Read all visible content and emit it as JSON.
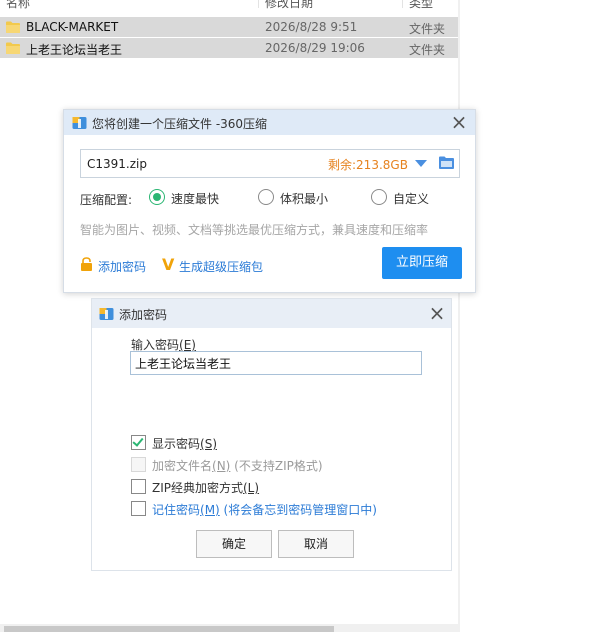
{
  "explorer": {
    "columns": {
      "name": "名称",
      "date": "修改日期",
      "type": "类型"
    },
    "files": [
      {
        "name": "BLACK-MARKET",
        "date": "2026/8/28 9:51",
        "type": "文件夹"
      },
      {
        "name": "上老王论坛当老王",
        "date": "2026/8/29 19:06",
        "type": "文件夹"
      }
    ]
  },
  "compress_dialog": {
    "title": "您将创建一个压缩文件 -360压缩",
    "filename": "C1391.zip",
    "free_space": "剩余:213.8GB",
    "config_label": "压缩配置:",
    "options": {
      "fastest": "速度最快",
      "smallest": "体积最小",
      "custom": "自定义"
    },
    "selected_option": "fastest",
    "hint": "智能为图片、视频、文档等挑选最优压缩方式，兼具速度和压缩率",
    "add_password_link": "添加密码",
    "super_pack_link": "生成超级压缩包",
    "compress_button": "立即压缩"
  },
  "password_dialog": {
    "title": "添加密码",
    "input_label": "输入密码",
    "input_label_key": "(E)",
    "password_value": "上老王论坛当老王",
    "show_password": {
      "label": "显示密码",
      "key": "(S)",
      "checked": true
    },
    "encrypt_filenames": {
      "label": "加密文件名",
      "key": "(N)",
      "note": " (不支持ZIP格式)",
      "checked": false,
      "disabled": true
    },
    "zip_classic": {
      "label": "ZIP经典加密方式",
      "key": "(L)",
      "checked": false
    },
    "remember_password": {
      "label": "记住密码",
      "key": "(M)",
      "note": " (将会备忘到密码管理窗口中)",
      "checked": false
    },
    "ok_button": "确定",
    "cancel_button": "取消"
  },
  "colors": {
    "accent": "#1e8ef0",
    "selected_radio": "#2bb673",
    "free_space": "#e6821e",
    "link": "#2b7bd6"
  }
}
